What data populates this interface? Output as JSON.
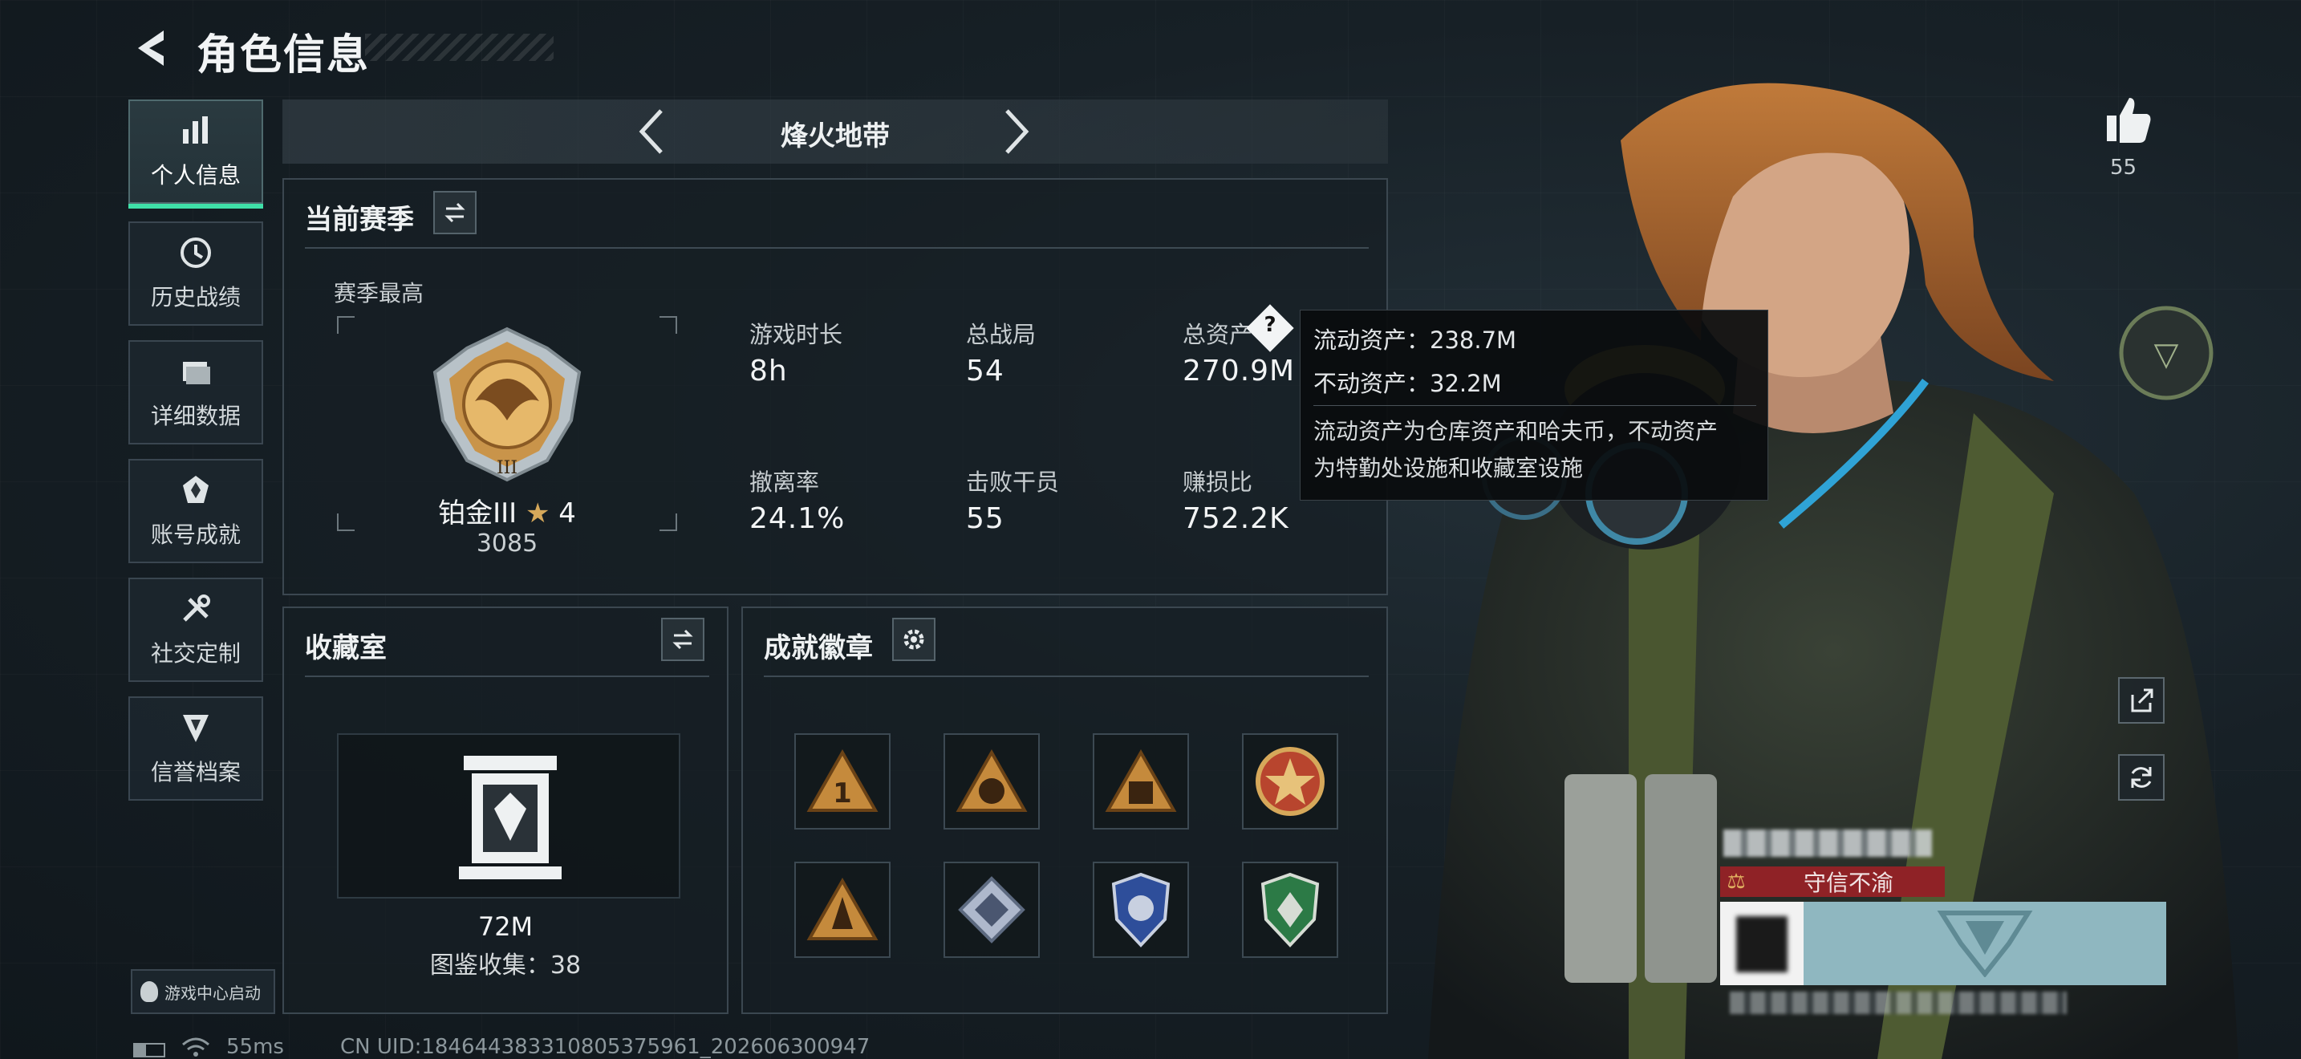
{
  "header": {
    "title": "角色信息"
  },
  "sidebar": {
    "items": [
      {
        "label": "个人信息",
        "icon": "bar-chart-icon",
        "active": true
      },
      {
        "label": "历史战绩",
        "icon": "clock-icon"
      },
      {
        "label": "详细数据",
        "icon": "folder-icon"
      },
      {
        "label": "账号成就",
        "icon": "achievement-icon"
      },
      {
        "label": "社交定制",
        "icon": "tools-icon"
      },
      {
        "label": "信誉档案",
        "icon": "shield-icon"
      }
    ],
    "game_center_label": "游戏中心启动"
  },
  "mode_tab": {
    "title": "烽火地带"
  },
  "season": {
    "title": "当前赛季",
    "best_label": "赛季最高",
    "rank_name": "铂金III",
    "rank_stars": "4",
    "rank_score": "3085",
    "stats": [
      {
        "label": "游戏时长",
        "value": "8h"
      },
      {
        "label": "总战局",
        "value": "54"
      },
      {
        "label": "总资产",
        "value": "270.9M"
      },
      {
        "label": "撤离率",
        "value": "24.1%"
      },
      {
        "label": "击败干员",
        "value": "55"
      },
      {
        "label": "赚损比",
        "value": "752.2K"
      }
    ]
  },
  "tooltip": {
    "liquid": "流动资产：238.7M",
    "fixed": "不动资产：32.2M",
    "desc_line1": "流动资产为仓库资产和哈夫币，不动资产",
    "desc_line2": "为特勤处设施和收藏室设施"
  },
  "collection": {
    "title": "收藏室",
    "value": "72M",
    "collected": "图鉴收集：38"
  },
  "badges": {
    "title": "成就徽章",
    "items": [
      "badge-1-icon",
      "badge-2-icon",
      "badge-3-icon",
      "badge-4-icon",
      "badge-5-icon",
      "badge-6-icon",
      "badge-7-icon",
      "badge-8-icon"
    ]
  },
  "right": {
    "likes": "55",
    "reputation_title": "守信不渝"
  },
  "status_bar": {
    "ping": "55ms",
    "uid": "CN UID:184644383310805375961_202606300947"
  },
  "colors": {
    "accent": "#3fe0a8",
    "gold": "#d6a85a",
    "reputation": "#a5262a"
  }
}
